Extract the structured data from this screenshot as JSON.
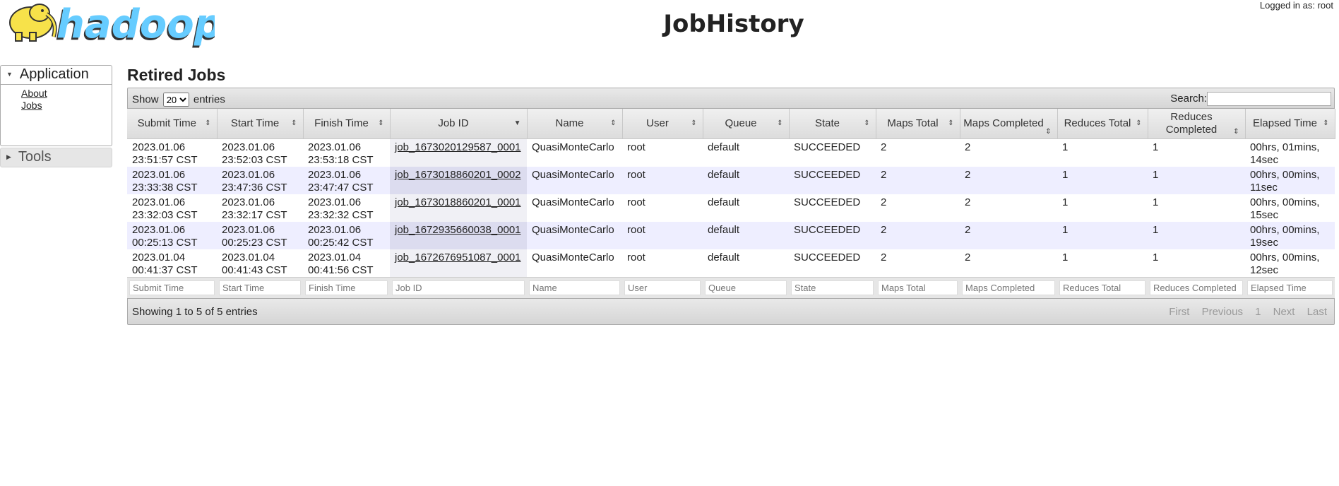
{
  "header": {
    "logo_text": "hadoop",
    "title": "JobHistory",
    "logged_in": "Logged in as: root"
  },
  "nav": {
    "application_label": "Application",
    "links": [
      "About",
      "Jobs"
    ],
    "tools_label": "Tools"
  },
  "section_title": "Retired Jobs",
  "table_controls": {
    "show_label": "Show",
    "length_value": "20",
    "entries_label": "entries",
    "search_label": "Search:"
  },
  "columns": [
    "Submit Time",
    "Start Time",
    "Finish Time",
    "Job ID",
    "Name",
    "User",
    "Queue",
    "State",
    "Maps Total",
    "Maps Completed",
    "Reduces Total",
    "Reduces Completed",
    "Elapsed Time"
  ],
  "rows": [
    {
      "submit_date": "2023.01.06",
      "submit_time": "23:51:57 CST",
      "start_date": "2023.01.06",
      "start_time": "23:52:03 CST",
      "finish_date": "2023.01.06",
      "finish_time": "23:53:18 CST",
      "job_id": "job_1673020129587_0001",
      "name": "QuasiMonteCarlo",
      "user": "root",
      "queue": "default",
      "state": "SUCCEEDED",
      "maps_total": "2",
      "maps_completed": "2",
      "reduces_total": "1",
      "reduces_completed": "1",
      "elapsed_a": "00hrs, 01mins,",
      "elapsed_b": "14sec"
    },
    {
      "submit_date": "2023.01.06",
      "submit_time": "23:33:38 CST",
      "start_date": "2023.01.06",
      "start_time": "23:47:36 CST",
      "finish_date": "2023.01.06",
      "finish_time": "23:47:47 CST",
      "job_id": "job_1673018860201_0002",
      "name": "QuasiMonteCarlo",
      "user": "root",
      "queue": "default",
      "state": "SUCCEEDED",
      "maps_total": "2",
      "maps_completed": "2",
      "reduces_total": "1",
      "reduces_completed": "1",
      "elapsed_a": "00hrs, 00mins,",
      "elapsed_b": "11sec"
    },
    {
      "submit_date": "2023.01.06",
      "submit_time": "23:32:03 CST",
      "start_date": "2023.01.06",
      "start_time": "23:32:17 CST",
      "finish_date": "2023.01.06",
      "finish_time": "23:32:32 CST",
      "job_id": "job_1673018860201_0001",
      "name": "QuasiMonteCarlo",
      "user": "root",
      "queue": "default",
      "state": "SUCCEEDED",
      "maps_total": "2",
      "maps_completed": "2",
      "reduces_total": "1",
      "reduces_completed": "1",
      "elapsed_a": "00hrs, 00mins,",
      "elapsed_b": "15sec"
    },
    {
      "submit_date": "2023.01.06",
      "submit_time": "00:25:13 CST",
      "start_date": "2023.01.06",
      "start_time": "00:25:23 CST",
      "finish_date": "2023.01.06",
      "finish_time": "00:25:42 CST",
      "job_id": "job_1672935660038_0001",
      "name": "QuasiMonteCarlo",
      "user": "root",
      "queue": "default",
      "state": "SUCCEEDED",
      "maps_total": "2",
      "maps_completed": "2",
      "reduces_total": "1",
      "reduces_completed": "1",
      "elapsed_a": "00hrs, 00mins,",
      "elapsed_b": "19sec"
    },
    {
      "submit_date": "2023.01.04",
      "submit_time": "00:41:37 CST",
      "start_date": "2023.01.04",
      "start_time": "00:41:43 CST",
      "finish_date": "2023.01.04",
      "finish_time": "00:41:56 CST",
      "job_id": "job_1672676951087_0001",
      "name": "QuasiMonteCarlo",
      "user": "root",
      "queue": "default",
      "state": "SUCCEEDED",
      "maps_total": "2",
      "maps_completed": "2",
      "reduces_total": "1",
      "reduces_completed": "1",
      "elapsed_a": "00hrs, 00mins,",
      "elapsed_b": "12sec"
    }
  ],
  "footer": {
    "info": "Showing 1 to 5 of 5 entries",
    "pager": {
      "first": "First",
      "previous": "Previous",
      "page": "1",
      "next": "Next",
      "last": "Last"
    }
  },
  "colors": {
    "row_even": "#eeeeff",
    "sorted_col": "#dcdcef",
    "logo_elephant": "#f7e24a"
  }
}
